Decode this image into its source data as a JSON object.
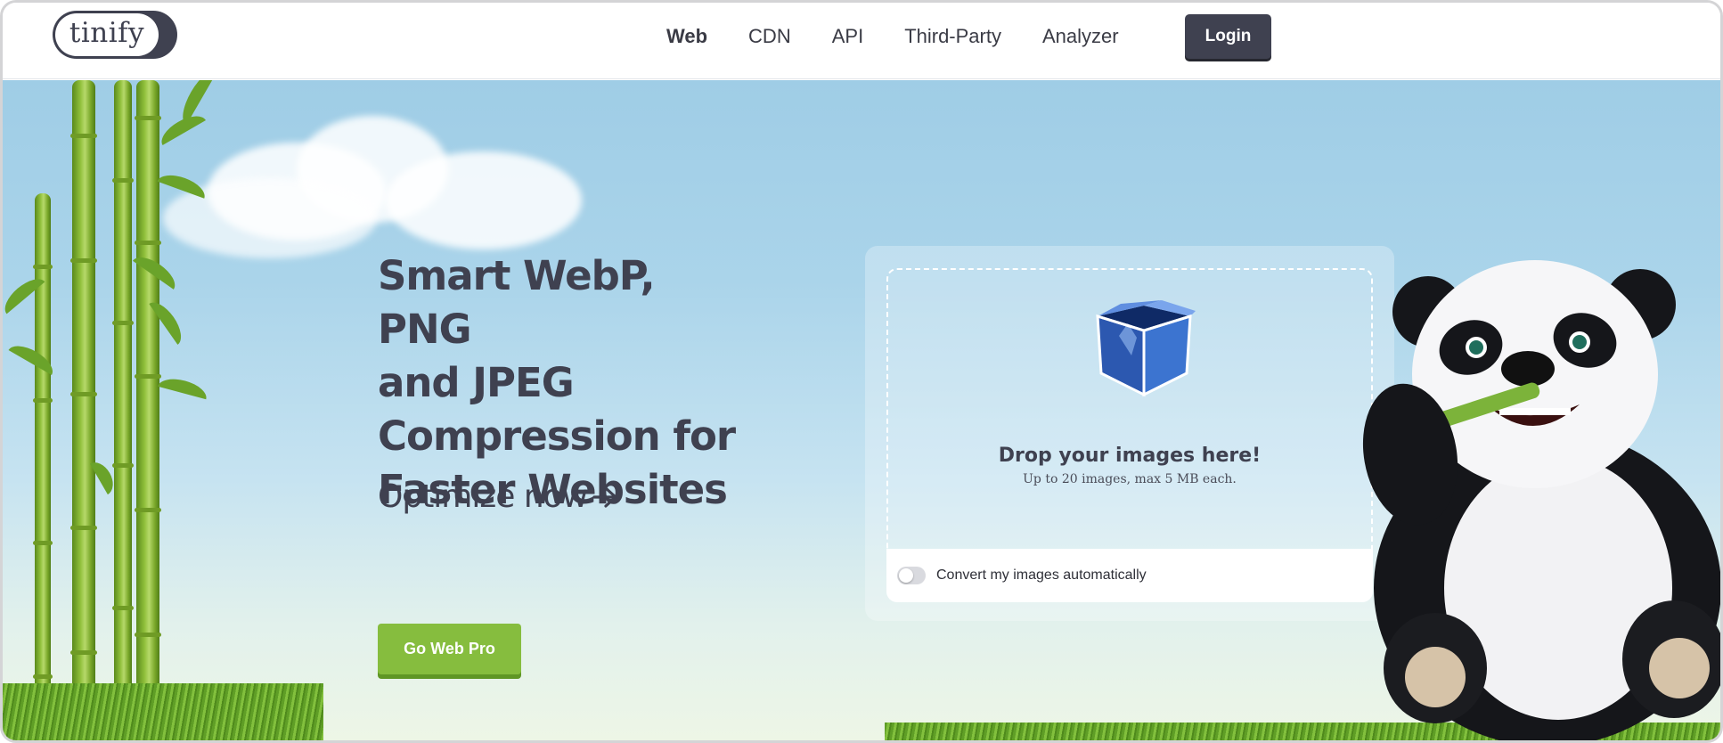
{
  "brand": {
    "logo_text": "tinify"
  },
  "nav": {
    "items": [
      {
        "label": "Web",
        "active": true
      },
      {
        "label": "CDN",
        "active": false
      },
      {
        "label": "API",
        "active": false
      },
      {
        "label": "Third-Party",
        "active": false
      },
      {
        "label": "Analyzer",
        "active": false
      }
    ],
    "login_label": "Login"
  },
  "hero": {
    "headline_lines": [
      "Smart WebP, PNG",
      "and JPEG",
      "Compression for",
      "Faster Websites"
    ],
    "optimize_label": "Optimize now",
    "optimize_icon": "arrow-right-icon",
    "pro_button_label": "Go Web Pro"
  },
  "uploader": {
    "icon": "open-box-icon",
    "title": "Drop your images here!",
    "subtitle": "Up to 20 images, max 5 MB each.",
    "convert_label": "Convert my images automatically",
    "convert_enabled": false
  },
  "colors": {
    "brand_dark": "#3f4150",
    "accent_green": "#86bd3e",
    "sky": "#9fcde6"
  }
}
